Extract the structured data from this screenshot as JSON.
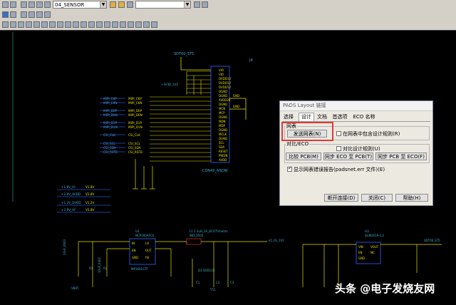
{
  "toolbar": {
    "layer_select": "04_SENSOR",
    "second_select": ""
  },
  "schematic": {
    "top_net": "SDT00_ST5",
    "ref_j": "J4",
    "connector": "CON40_NSDW",
    "left_nets": [
      "MIPI_CKP",
      "MIPI_CKN",
      "MIPI_D0P",
      "MIPI_D0N",
      "MIPI_D1P",
      "MIPI_D1N",
      "CSI_CLK",
      "CSI_SCL",
      "CSI_SDA",
      "CSI_RSTB"
    ],
    "left_short": [
      "MIPI_CKP",
      "MIPI_CKN",
      "MIPI_D0P",
      "MIPI_D0N",
      "MIPI_D1P",
      "MIPI_D1N",
      "CSI_CLK",
      "CSI_SCL",
      "CSI_SDA",
      "CSI_RSTB"
    ],
    "pins": [
      "VIO",
      "VIO",
      "DVDD12",
      "DVDD12",
      "DVDD12",
      "DGND",
      "DGND",
      "AVDD28",
      "DGND",
      "MCN",
      "MCP",
      "DGND",
      "MDN",
      "MDP",
      "DGND",
      "MCLK",
      "DGND",
      "SCL",
      "SDA",
      "RESET",
      "PWDN",
      "AVDD"
    ],
    "right_pins": [
      "GND",
      "GND",
      "GND"
    ],
    "supply_top": "+3V3D_1V2",
    "power_nets": [
      "+1.8V_IO",
      "+2.8V_AVDD",
      "+1.2V_DVDD",
      "+2.8V_AF"
    ],
    "power_labels": [
      "V1.8V",
      "V2.8V",
      "V1.2V",
      "V2.8V"
    ],
    "reg1_ref": "U1",
    "reg1_part": "NCP160AFCS",
    "reg1_pins": [
      "IN",
      "EN",
      "GND",
      "LX",
      "OUT",
      "FB"
    ],
    "reg1_part2": "MP1601GTF",
    "ind_label": "L1 2.2uH_1A_DCR75mohm",
    "ind_part": "IND_0503",
    "diode_label": "D3 SOD123",
    "res_labels": [
      "R1",
      "R2",
      "C1",
      "C2",
      "C3",
      "Y51"
    ],
    "reg2_ref": "U2",
    "reg2_part": "SGM2019-1.2",
    "reg2_pins": [
      "VIN",
      "EN",
      "GND",
      "VOUT",
      "NC"
    ],
    "reg2_net": "SDT00_ST5",
    "right_label": "V1.2V_1V2",
    "left_bottom_net": "VBAT",
    "cap_label": "10uF_0603",
    "cap_label2": "10uF_0402"
  },
  "dialog": {
    "title": "PADS Layout 链接",
    "tabs": [
      "选择",
      "设计",
      "文档",
      "首选项",
      "ECO 名称"
    ],
    "group_netlist": "网表",
    "send_netlist": "发送网表(N)",
    "include_rules": "在网表中包含设计规则(R)",
    "group_compare": "对比/ECO",
    "compare_rules": "对比设计规则(U)",
    "compare_pcb": "比较 PCB(M)",
    "sync_eco_to_pcb": "同步 ECO 至 PCB(T)",
    "sync_pcb_to_eco": "同步 PCB 至 ECO(F)",
    "show_report": "显示网表错误报告(padsnet.err 文件)(E)",
    "disconnect": "断开连接(D)",
    "close": "关闭(C)",
    "help": "帮助(H)"
  },
  "watermark": "头条 @电子发烧友网"
}
